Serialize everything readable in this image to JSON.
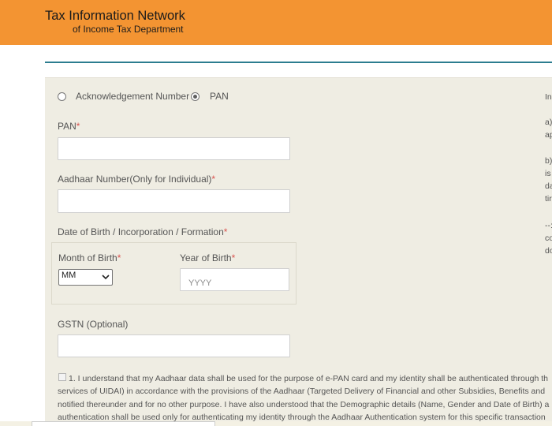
{
  "header": {
    "title_line1": "Tax Information Network",
    "title_line2": "of Income Tax Department"
  },
  "form": {
    "radio_options": [
      {
        "label": "Acknowledgement Number",
        "selected": false
      },
      {
        "label": "PAN",
        "selected": true
      }
    ],
    "pan_label": "PAN",
    "aadhaar_label": "Aadhaar Number(Only for Individual)",
    "dob_label": "Date of Birth / Incorporation / Formation",
    "month_label": "Month of Birth",
    "month_value": "MM",
    "year_label": "Year of Birth",
    "year_placeholder": "YYYY",
    "gstn_label": "GSTN (Optional)",
    "required_mark": "*",
    "consent_lines": [
      "1. I understand that my Aadhaar data shall be used for the purpose of e-PAN card and my identity shall be authenticated through th",
      "services of UIDAI) in accordance with the provisions of the Aadhaar (Targeted Delivery of Financial and other Subsidies, Benefits and",
      "notified thereunder and for no other purpose. I have also understood that the Demographic details (Name, Gender and Date of Birth) a",
      "authentication shall be used only for authenticating my identity through the Aadhaar Authentication system for this specific transaction"
    ]
  },
  "side_panel": {
    "lines": [
      "In",
      "a)",
      "ap",
      "b)",
      "is",
      "da",
      "tir",
      "--:",
      "co",
      "do"
    ]
  }
}
